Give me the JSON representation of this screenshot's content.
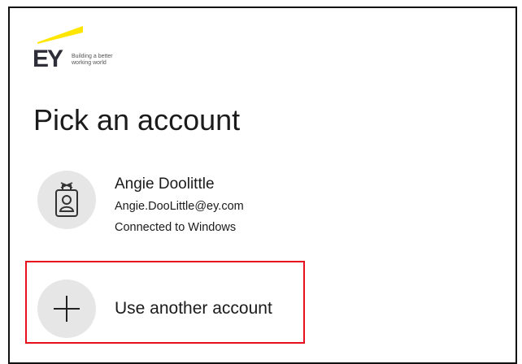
{
  "brand": {
    "logo_text": "EY",
    "tagline_line1": "Building a better",
    "tagline_line2": "working world",
    "accent_color": "#ffe600"
  },
  "page": {
    "title": "Pick an account"
  },
  "accounts": [
    {
      "name": "Angie Doolittle",
      "email": "Angie.DooLittle@ey.com",
      "status": "Connected to Windows",
      "icon": "id-badge-icon"
    }
  ],
  "another_account": {
    "label": "Use another account",
    "icon": "plus-icon"
  },
  "highlight_color": "#e8101e"
}
